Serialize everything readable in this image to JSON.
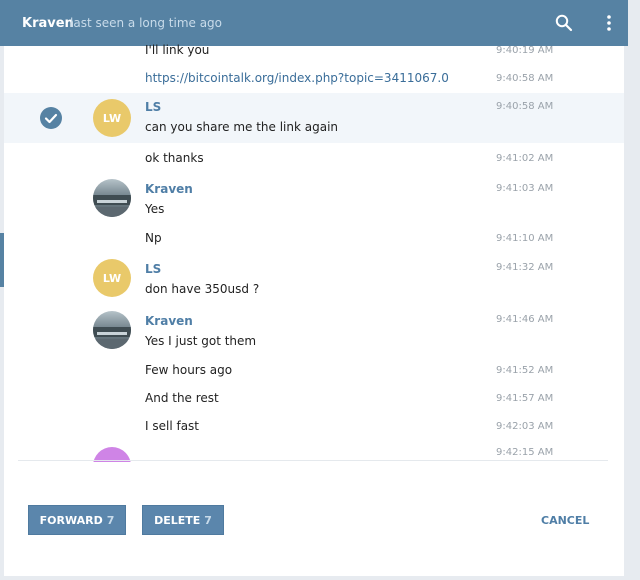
{
  "header": {
    "name": "Kraven",
    "status": "last seen a long time ago",
    "icons": [
      "search-icon",
      "more-vertical-icon"
    ]
  },
  "messages": [
    {
      "text": "I'll link you",
      "time": "9:40:19 AM"
    },
    {
      "text": "https://bitcointalk.org/index.php?topic=3411067.0",
      "time": "9:40:58 AM",
      "link": true
    },
    {
      "author": "LS",
      "avatar_initials": "LW",
      "text": "can you share me the link again",
      "time": "9:40:58 AM",
      "selected": true
    },
    {
      "text": "ok thanks",
      "time": "9:41:02 AM"
    },
    {
      "author": "Kraven",
      "avatar": "photo",
      "text": "Yes",
      "time": "9:41:03 AM"
    },
    {
      "text": "Np",
      "time": "9:41:10 AM"
    },
    {
      "author": "LS",
      "avatar_initials": "LW",
      "text": "don have 350usd  ?",
      "time": "9:41:32 AM"
    },
    {
      "author": "Kraven",
      "avatar": "photo",
      "text": "Yes I just got them",
      "time": "9:41:46 AM"
    },
    {
      "text": "Few hours ago",
      "time": "9:41:52 AM"
    },
    {
      "text": "And the rest",
      "time": "9:41:57 AM"
    },
    {
      "text": "I sell fast",
      "time": "9:42:03 AM"
    },
    {
      "text": "",
      "time": "9:42:15 AM"
    }
  ],
  "footer": {
    "forward_label": "FORWARD",
    "forward_count": "7",
    "delete_label": "DELETE",
    "delete_count": "7",
    "cancel_label": "CANCEL"
  },
  "colors": {
    "accent": "#5682a3",
    "author": "#4f7ea6",
    "avatar_lw": "#e9c96a",
    "avatar_purple": "#cf84e6"
  }
}
